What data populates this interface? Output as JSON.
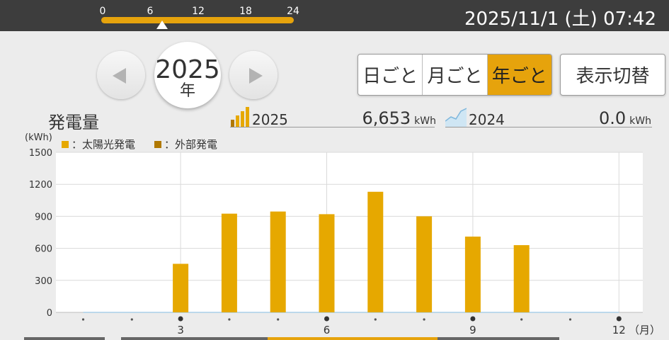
{
  "header": {
    "time_scale_labels": [
      "0",
      "6",
      "12",
      "18",
      "24"
    ],
    "datetime": "2025/11/1 (土) 07:42"
  },
  "nav": {
    "year": "2025",
    "year_unit": "年"
  },
  "view_tabs": [
    "日ごと",
    "月ごと",
    "年ごと"
  ],
  "active_tab": "年ごと",
  "switch_label": "表示切替",
  "summary": {
    "title": "発電量",
    "current_year": "2025",
    "current_value": "6,653",
    "compare_year": "2024",
    "compare_value": "0.0",
    "unit": "kWh"
  },
  "legend": {
    "unit_label": "(kWh)",
    "items": [
      {
        "label": "：太陽光発電",
        "color": "#e6a800"
      },
      {
        "label": "：外部発電",
        "color": "#b07800"
      }
    ]
  },
  "chart_data": {
    "type": "bar",
    "x": [
      1,
      2,
      3,
      4,
      5,
      6,
      7,
      8,
      9,
      10,
      11,
      12
    ],
    "x_tick_labels": [
      "3",
      "6",
      "9",
      "12"
    ],
    "x_unit_label": "（月）",
    "ylim": [
      0,
      1500
    ],
    "y_ticks": [
      0,
      300,
      600,
      900,
      1200,
      1500
    ],
    "series": [
      {
        "name": "太陽光発電",
        "values": [
          0,
          0,
          455,
          925,
          945,
          920,
          1130,
          900,
          710,
          630,
          0,
          0
        ]
      },
      {
        "name": "外部発電",
        "values": [
          0,
          0,
          0,
          0,
          0,
          0,
          0,
          0,
          0,
          0,
          0,
          0
        ]
      }
    ],
    "comparison_line": {
      "name": "2024",
      "values": [
        0,
        0,
        0,
        0,
        0,
        0,
        0,
        0,
        0,
        0,
        0,
        0
      ]
    },
    "grid": true,
    "legend_position": "top-left"
  }
}
